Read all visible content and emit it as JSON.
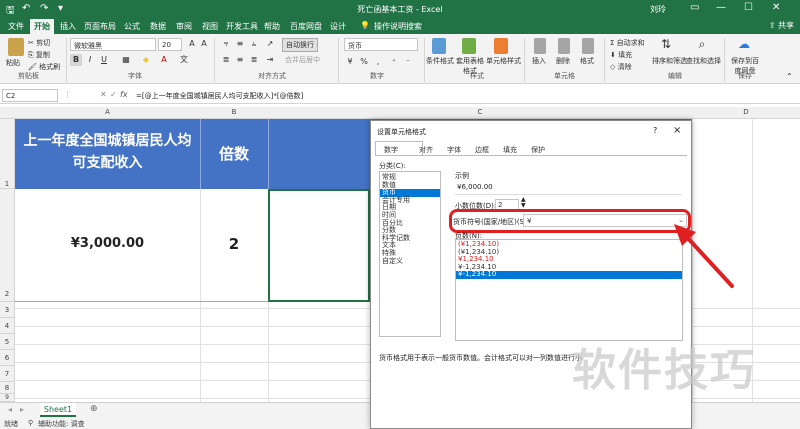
{
  "window": {
    "title": "死亡函基本工资 - Excel",
    "user": "刘玲"
  },
  "tabs": [
    "文件",
    "开始",
    "插入",
    "页面布局",
    "公式",
    "数据",
    "审阅",
    "视图",
    "开发工具",
    "帮助",
    "百度网盘",
    "设计"
  ],
  "tell_me": "操作说明搜索",
  "share": "共享",
  "ribbon": {
    "paste": "粘贴",
    "cut": "剪切",
    "copy": "复制",
    "format_painter": "格式刷",
    "font_name": "微软雅黑",
    "font_size": "20",
    "wrap": "自动换行",
    "merge": "合并后居中",
    "number_format": "货币",
    "cond_format": "条件格式",
    "table_format": "套用表格格式",
    "cell_style": "单元格样式",
    "insert": "插入",
    "delete": "删除",
    "format": "格式",
    "autosum": "自动求和",
    "fill": "填充",
    "clear": "清除",
    "sort_filter": "排序和筛选",
    "find_select": "查找和选择",
    "save_baidu": "保存到百度网盘",
    "groups": [
      "剪贴板",
      "字体",
      "对齐方式",
      "数字",
      "样式",
      "单元格",
      "编辑",
      "保存"
    ]
  },
  "formula": {
    "name_box": "C2",
    "fx": "fx",
    "content": "=[@上一年度全国城镇居民人均可支配收入]*[@倍数]"
  },
  "columns": [
    "A",
    "B",
    "C",
    "D"
  ],
  "rows": [
    "1",
    "2",
    "3",
    "4",
    "5",
    "6",
    "7",
    "8",
    "9",
    "10"
  ],
  "cells": {
    "a1": "上一年度全国城镇居民人均可支配收入",
    "b1": "倍数",
    "a2": "¥3,000.00",
    "b2": "2"
  },
  "sheet": {
    "name": "Sheet1",
    "add": "⊕"
  },
  "status": {
    "ready": "就绪",
    "accessibility": "辅助功能: 调查"
  },
  "dialog": {
    "title": "设置单元格格式",
    "help": "?",
    "close": "×",
    "tabs": [
      "数字",
      "对齐",
      "字体",
      "边框",
      "填充",
      "保护"
    ],
    "category_label": "分类(C):",
    "categories": [
      "常规",
      "数值",
      "货币",
      "会计专用",
      "日期",
      "时间",
      "百分比",
      "分数",
      "科学记数",
      "文本",
      "特殊",
      "自定义"
    ],
    "selected_category": "货币",
    "sample_label": "示例",
    "sample_value": "¥6,000.00",
    "decimal_label": "小数位数(D):",
    "decimal_value": "2",
    "symbol_label": "货币符号(国家/地区)(S):",
    "symbol_value": "¥",
    "negative_label": "负数(N):",
    "negatives": [
      "(¥1,234.10)",
      "(¥1,234.10)",
      "¥1,234.10",
      "¥-1,234.10",
      "¥-1,234.10"
    ],
    "description": "货币格式用于表示一般货币数值。会计格式可以对一列数值进行小"
  },
  "watermark": "软件技巧",
  "colors": {
    "excel_green": "#217346",
    "header_fill": "#4472c4",
    "highlight_red": "#e02020"
  }
}
